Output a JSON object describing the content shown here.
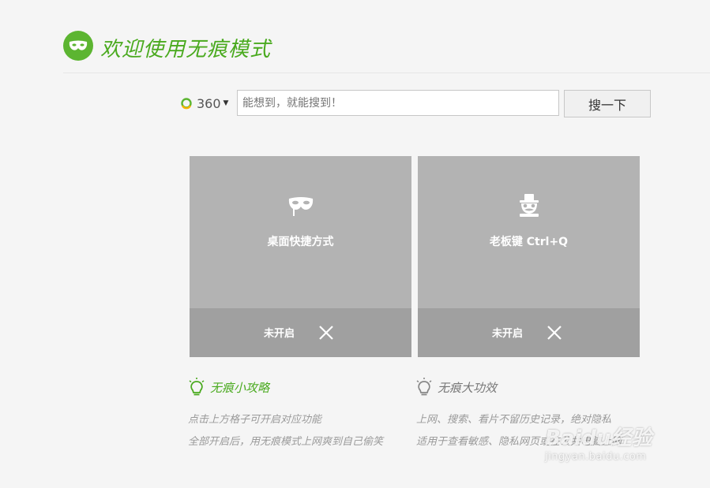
{
  "colors": {
    "brand_green": "#5cb531",
    "title_green": "#4aaa1f",
    "tile_top": "#b3b3b3",
    "tile_bottom": "#a0a0a0",
    "tip_text": "#9a9a9a"
  },
  "header": {
    "logo_icon": "mask-icon",
    "title": "欢迎使用无痕模式"
  },
  "search": {
    "engine_label": "360",
    "engine_icon": "360-search-icon",
    "placeholder": "能想到，就能搜到！",
    "button_label": "搜一下"
  },
  "cards": [
    {
      "icon": "mask-icon",
      "label": "桌面快捷方式",
      "status": "未开启",
      "status_icon": "close-icon"
    },
    {
      "icon": "boss-disguise-icon",
      "label": "老板键 Ctrl+Q",
      "status": "未开启",
      "status_icon": "close-icon"
    }
  ],
  "tips": [
    {
      "icon": "lightbulb-icon",
      "title": "无痕小攻略",
      "title_color": "#4aaa1f",
      "lines": [
        "点击上方格子可开启对应功能",
        "全部开启后，用无痕模式上网爽到自己偷笑"
      ]
    },
    {
      "icon": "lightbulb-icon",
      "title": "无痕大功效",
      "title_color": "#777777",
      "lines": [
        "上网、搜索、看片不留历史记录，绝对隐私",
        "适用于查看敏感、隐私网页或在公共电脑上网"
      ]
    }
  ],
  "watermark": {
    "text": "Baidu经验",
    "url": "jingyan.baidu.com"
  }
}
